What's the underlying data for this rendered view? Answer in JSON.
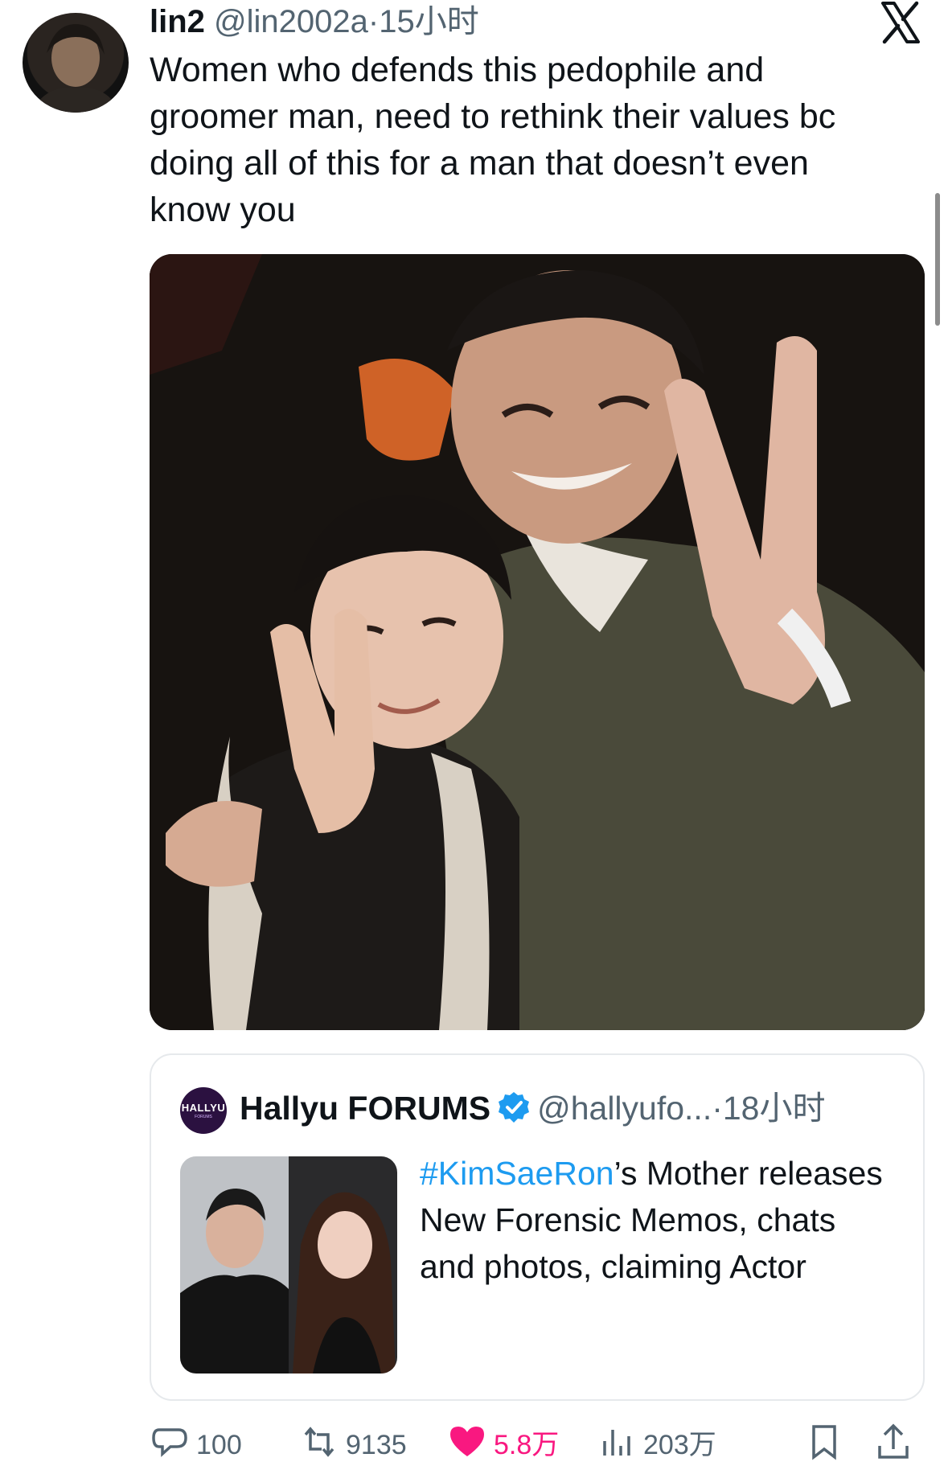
{
  "tweet": {
    "author_name": "lin2",
    "author_handle": "@lin2002a",
    "separator": "·",
    "time": "15小时",
    "text": "Women who defends  this pedophile and groomer man, need to rethink their values bc doing all of this for a man that doesn’t even know you"
  },
  "app": {
    "logo_icon": "x-logo-icon"
  },
  "quote": {
    "avatar_text": "HALLYU",
    "avatar_subtext": "FORUMS",
    "author_name": "Hallyu FORUMS",
    "verified_icon": "verified-badge-icon",
    "author_handle": "@hallyufo...",
    "separator": "·",
    "time": "18小时",
    "hashtag": "#KimSaeRon",
    "text_rest": "’s Mother releases New Forensic Memos, chats and photos, claiming Actor"
  },
  "actions": {
    "replies": "100",
    "retweets": "9135",
    "likes": "5.8万",
    "views": "203万"
  },
  "colors": {
    "accent": "#1d9bf0",
    "like": "#f91880",
    "muted": "#536471",
    "text": "#0f1419"
  }
}
